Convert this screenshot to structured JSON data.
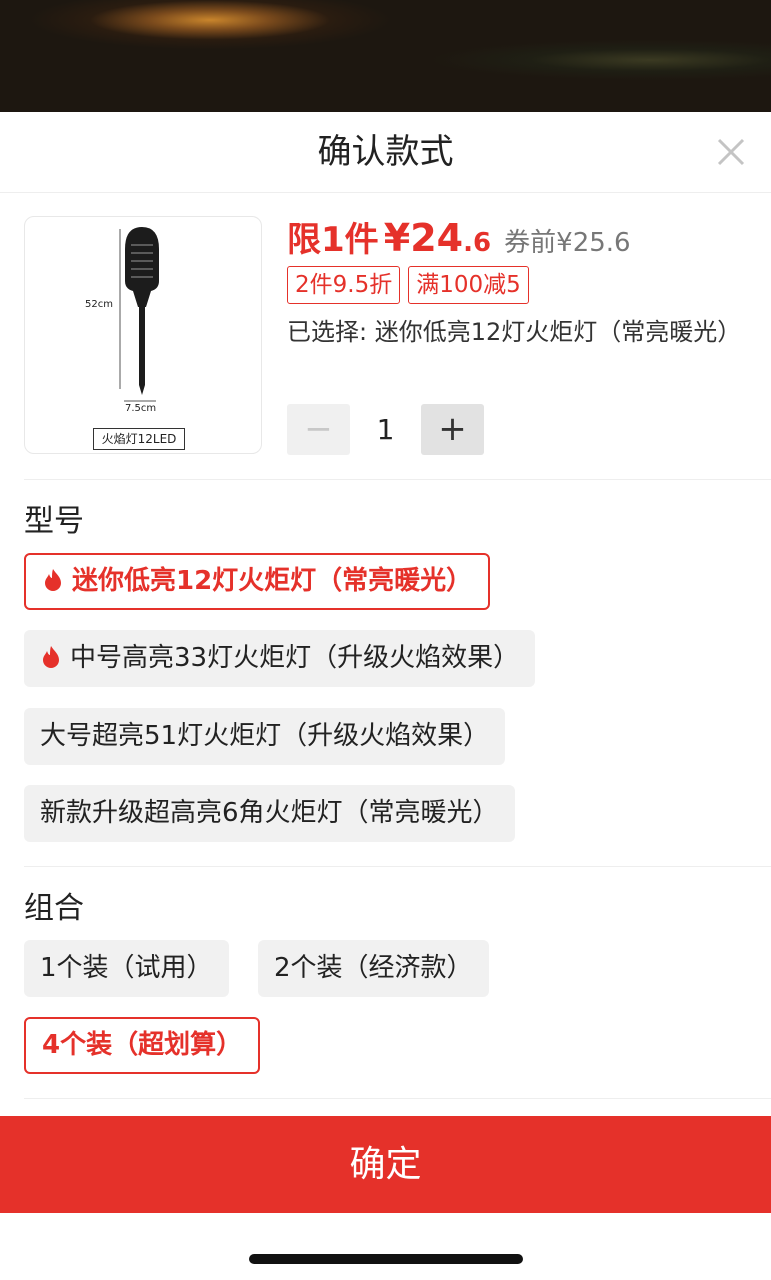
{
  "header": {
    "title": "确认款式"
  },
  "product": {
    "image_label": "火焰灯12LED",
    "image_height_label": "52cm",
    "image_width_label": "7.5cm",
    "price_limit": "限1件",
    "price_main": "¥24",
    "price_decimal": ".6",
    "coupon_price": "券前¥25.6",
    "tags": [
      "2件9.5折",
      "满100减5"
    ],
    "selected_text": "已选择: 迷你低亮12灯火炬灯（常亮暖光）",
    "quantity": "1",
    "minus_label": "−",
    "plus_label": "+"
  },
  "sections": {
    "model_title": "型号",
    "combo_title": "组合"
  },
  "models": [
    {
      "label": "迷你低亮12灯火炬灯（常亮暖光）",
      "selected": true,
      "hot": true
    },
    {
      "label": "中号高亮33灯火炬灯（升级火焰效果）",
      "selected": false,
      "hot": true
    },
    {
      "label": "大号超亮51灯火炬灯（升级火焰效果）",
      "selected": false,
      "hot": false
    },
    {
      "label": "新款升级超高亮6角火炬灯（常亮暖光）",
      "selected": false,
      "hot": false
    }
  ],
  "combos": [
    {
      "label": "1个装（试用）",
      "selected": false
    },
    {
      "label": "2个装（经济款）",
      "selected": false
    },
    {
      "label": "4个装（超划算）",
      "selected": true
    }
  ],
  "footer": {
    "confirm_label": "确定"
  },
  "colors": {
    "accent": "#e5312a",
    "chip_bg": "#f1f1f1"
  },
  "icons": {
    "close": "close-icon",
    "hot": "fire-icon"
  }
}
